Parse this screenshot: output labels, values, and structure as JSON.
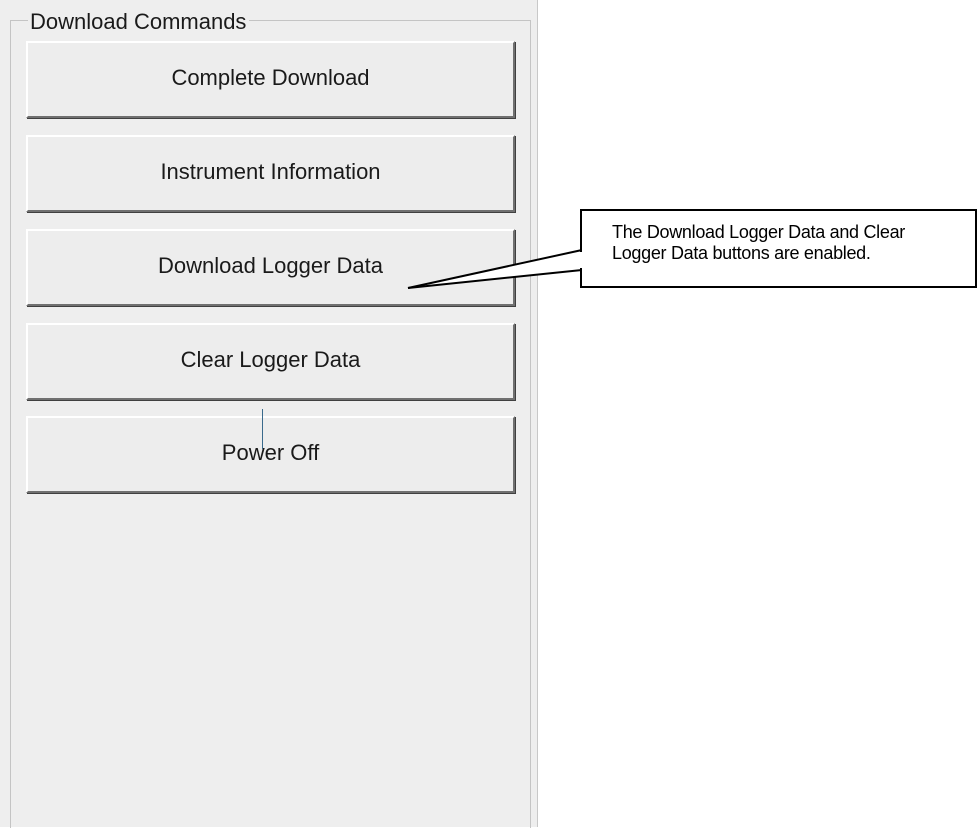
{
  "group": {
    "title": "Download Commands"
  },
  "buttons": {
    "complete_download": "Complete Download",
    "instrument_information": "Instrument Information",
    "download_logger_data": "Download Logger Data",
    "clear_logger_data": "Clear Logger Data",
    "power_off": "Power Off"
  },
  "callout": {
    "text": "The Download Logger Data and Clear Logger Data buttons are enabled."
  }
}
